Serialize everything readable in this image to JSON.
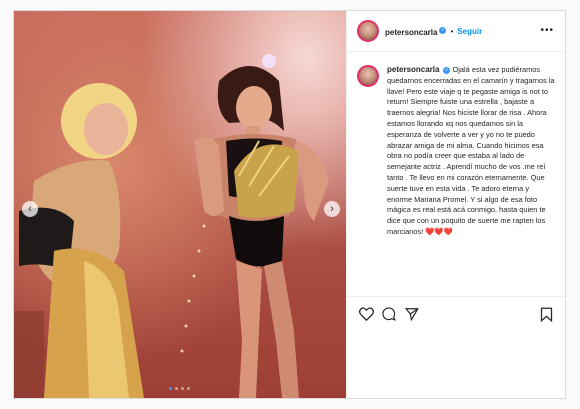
{
  "post": {
    "username": "petersoncarla",
    "follow_label": "Seguir",
    "more_label": "•••",
    "caption": "Ojalá esta vez pudiéramos quedarnos encerradas en el camarín y tragarnos la llave! Pero este viaje q te pegaste amiga is not to return! Siempre fuiste una estrella , bajaste a traernos alegria! Nos hiciste llorar de risa . Ahora estamos llorando xq nos quedamos sin la esperanza de volverte a ver y yo no te puedo abrazar amiga de mi alma. Cuando hicimos esa obra no podía creer que estaba al lado de semejante actriz . Aprendí mucho de vos .me reí tanto . Te llevo en mi corazón eternamente. Que suerte tuve en esta vida . Te adoro eterna y enorme Mariana Promel. Y si algo de esa foto mágica es real está acá conmigo. hasta quien te dice que con un poquito de suerte me rapten los marcianos!",
    "caption_emoji": "❤️❤️❤️",
    "carousel": {
      "count": 4,
      "active_index": 0
    }
  },
  "icons": {
    "verified": "verified-badge-icon",
    "prev": "chevron-left-icon",
    "next": "chevron-right-icon",
    "like": "heart-icon",
    "comment": "comment-icon",
    "share": "share-icon",
    "save": "bookmark-icon"
  },
  "colors": {
    "link": "#0095f6",
    "verified": "#3897f0",
    "text": "#262626"
  }
}
